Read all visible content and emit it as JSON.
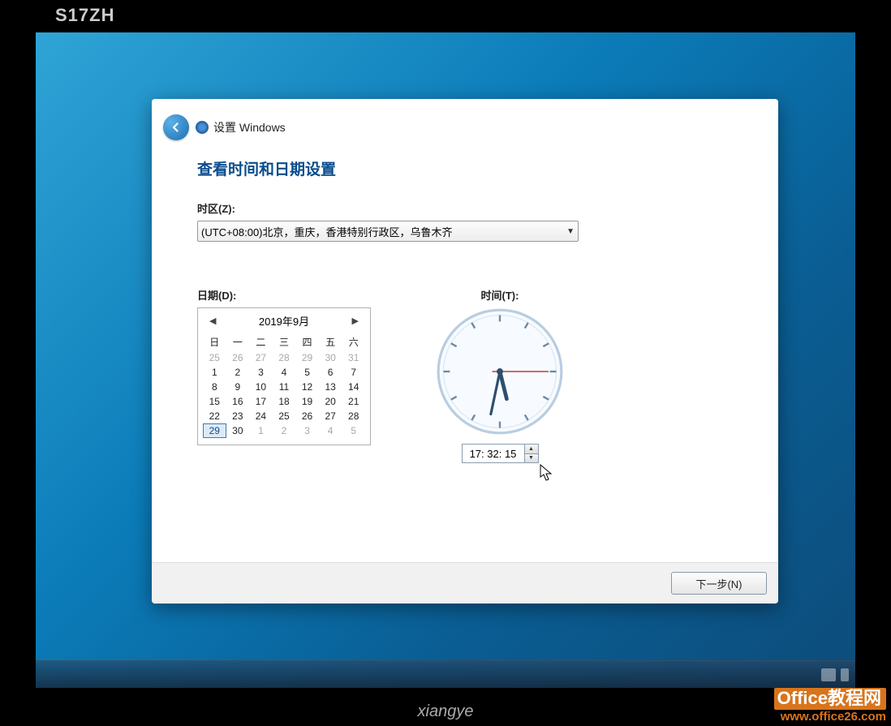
{
  "monitor": {
    "label": "S17ZH",
    "brand": "xiangye"
  },
  "watermark": {
    "line1": "Office教程网",
    "line2": "www.office26.com"
  },
  "header": {
    "title": "设置 Windows"
  },
  "page": {
    "title": "查看时间和日期设置",
    "timezone_label": "时区(Z):",
    "timezone_value": "(UTC+08:00)北京，重庆，香港特别行政区，乌鲁木齐",
    "date_label": "日期(D):",
    "time_label": "时间(T):"
  },
  "calendar": {
    "month_label": "2019年9月",
    "dow": [
      "日",
      "一",
      "二",
      "三",
      "四",
      "五",
      "六"
    ],
    "weeks": [
      [
        {
          "d": 25,
          "out": true
        },
        {
          "d": 26,
          "out": true
        },
        {
          "d": 27,
          "out": true
        },
        {
          "d": 28,
          "out": true
        },
        {
          "d": 29,
          "out": true
        },
        {
          "d": 30,
          "out": true
        },
        {
          "d": 31,
          "out": true
        }
      ],
      [
        {
          "d": 1
        },
        {
          "d": 2
        },
        {
          "d": 3
        },
        {
          "d": 4
        },
        {
          "d": 5
        },
        {
          "d": 6
        },
        {
          "d": 7
        }
      ],
      [
        {
          "d": 8
        },
        {
          "d": 9
        },
        {
          "d": 10
        },
        {
          "d": 11
        },
        {
          "d": 12
        },
        {
          "d": 13
        },
        {
          "d": 14
        }
      ],
      [
        {
          "d": 15
        },
        {
          "d": 16
        },
        {
          "d": 17
        },
        {
          "d": 18
        },
        {
          "d": 19
        },
        {
          "d": 20
        },
        {
          "d": 21
        }
      ],
      [
        {
          "d": 22
        },
        {
          "d": 23
        },
        {
          "d": 24
        },
        {
          "d": 25
        },
        {
          "d": 26
        },
        {
          "d": 27
        },
        {
          "d": 28
        }
      ],
      [
        {
          "d": 29,
          "selected": true
        },
        {
          "d": 30
        },
        {
          "d": 1,
          "out": true
        },
        {
          "d": 2,
          "out": true
        },
        {
          "d": 3,
          "out": true
        },
        {
          "d": 4,
          "out": true
        },
        {
          "d": 5,
          "out": true
        }
      ]
    ]
  },
  "time": {
    "value": "17: 32: 15",
    "hour": 17,
    "minute": 32,
    "second": 15
  },
  "footer": {
    "next_label": "下一步(N)"
  }
}
